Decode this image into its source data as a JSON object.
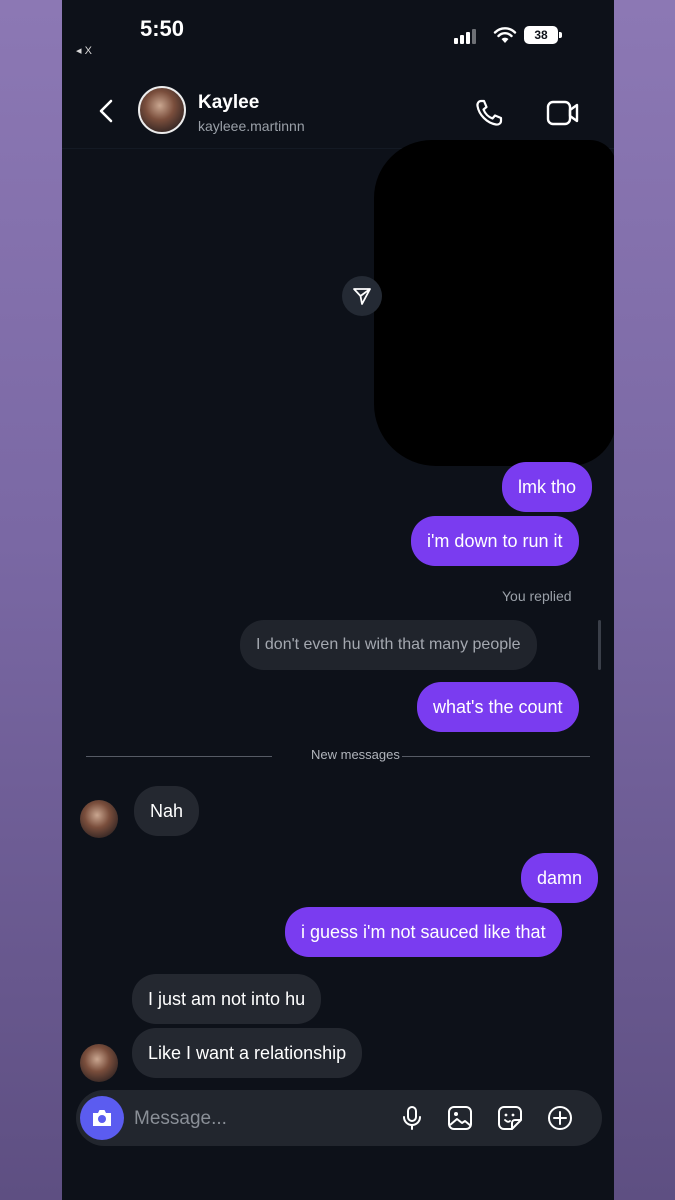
{
  "status_bar": {
    "time": "5:50",
    "back_app": "◂ X",
    "battery": "38"
  },
  "header": {
    "name": "Kaylee",
    "handle": "kayleee.martinnn"
  },
  "messages": [
    {
      "id": "m1",
      "text": "lmk tho",
      "direction": "outgoing"
    },
    {
      "id": "m2",
      "text": "i'm down to run it",
      "direction": "outgoing"
    },
    {
      "id": "m3",
      "text": "what's the count",
      "direction": "outgoing"
    },
    {
      "id": "m4",
      "text": "Nah",
      "direction": "incoming"
    },
    {
      "id": "m5",
      "text": "damn",
      "direction": "outgoing"
    },
    {
      "id": "m6",
      "text": "i guess i'm not sauced like that",
      "direction": "outgoing"
    },
    {
      "id": "m7",
      "text": "I just am not into hu",
      "direction": "incoming"
    },
    {
      "id": "m8",
      "text": "Like I want a relationship",
      "direction": "incoming"
    }
  ],
  "reply": {
    "label": "You replied",
    "quoted_text": "I don't even hu with that many people"
  },
  "divider": {
    "label": "New messages"
  },
  "composer": {
    "placeholder": "Message..."
  },
  "icons": {
    "back": "chevron-left-icon",
    "call": "phone-icon",
    "video": "video-camera-icon",
    "share": "send-icon",
    "camera": "camera-icon",
    "mic": "microphone-icon",
    "gallery": "image-icon",
    "sticker": "sticker-icon",
    "plus": "plus-circle-icon"
  },
  "colors": {
    "outgoing_bubble": "#7a3cf0",
    "incoming_bubble": "#242830",
    "background": "#0d1119",
    "camera_button": "#5b5cf0"
  }
}
